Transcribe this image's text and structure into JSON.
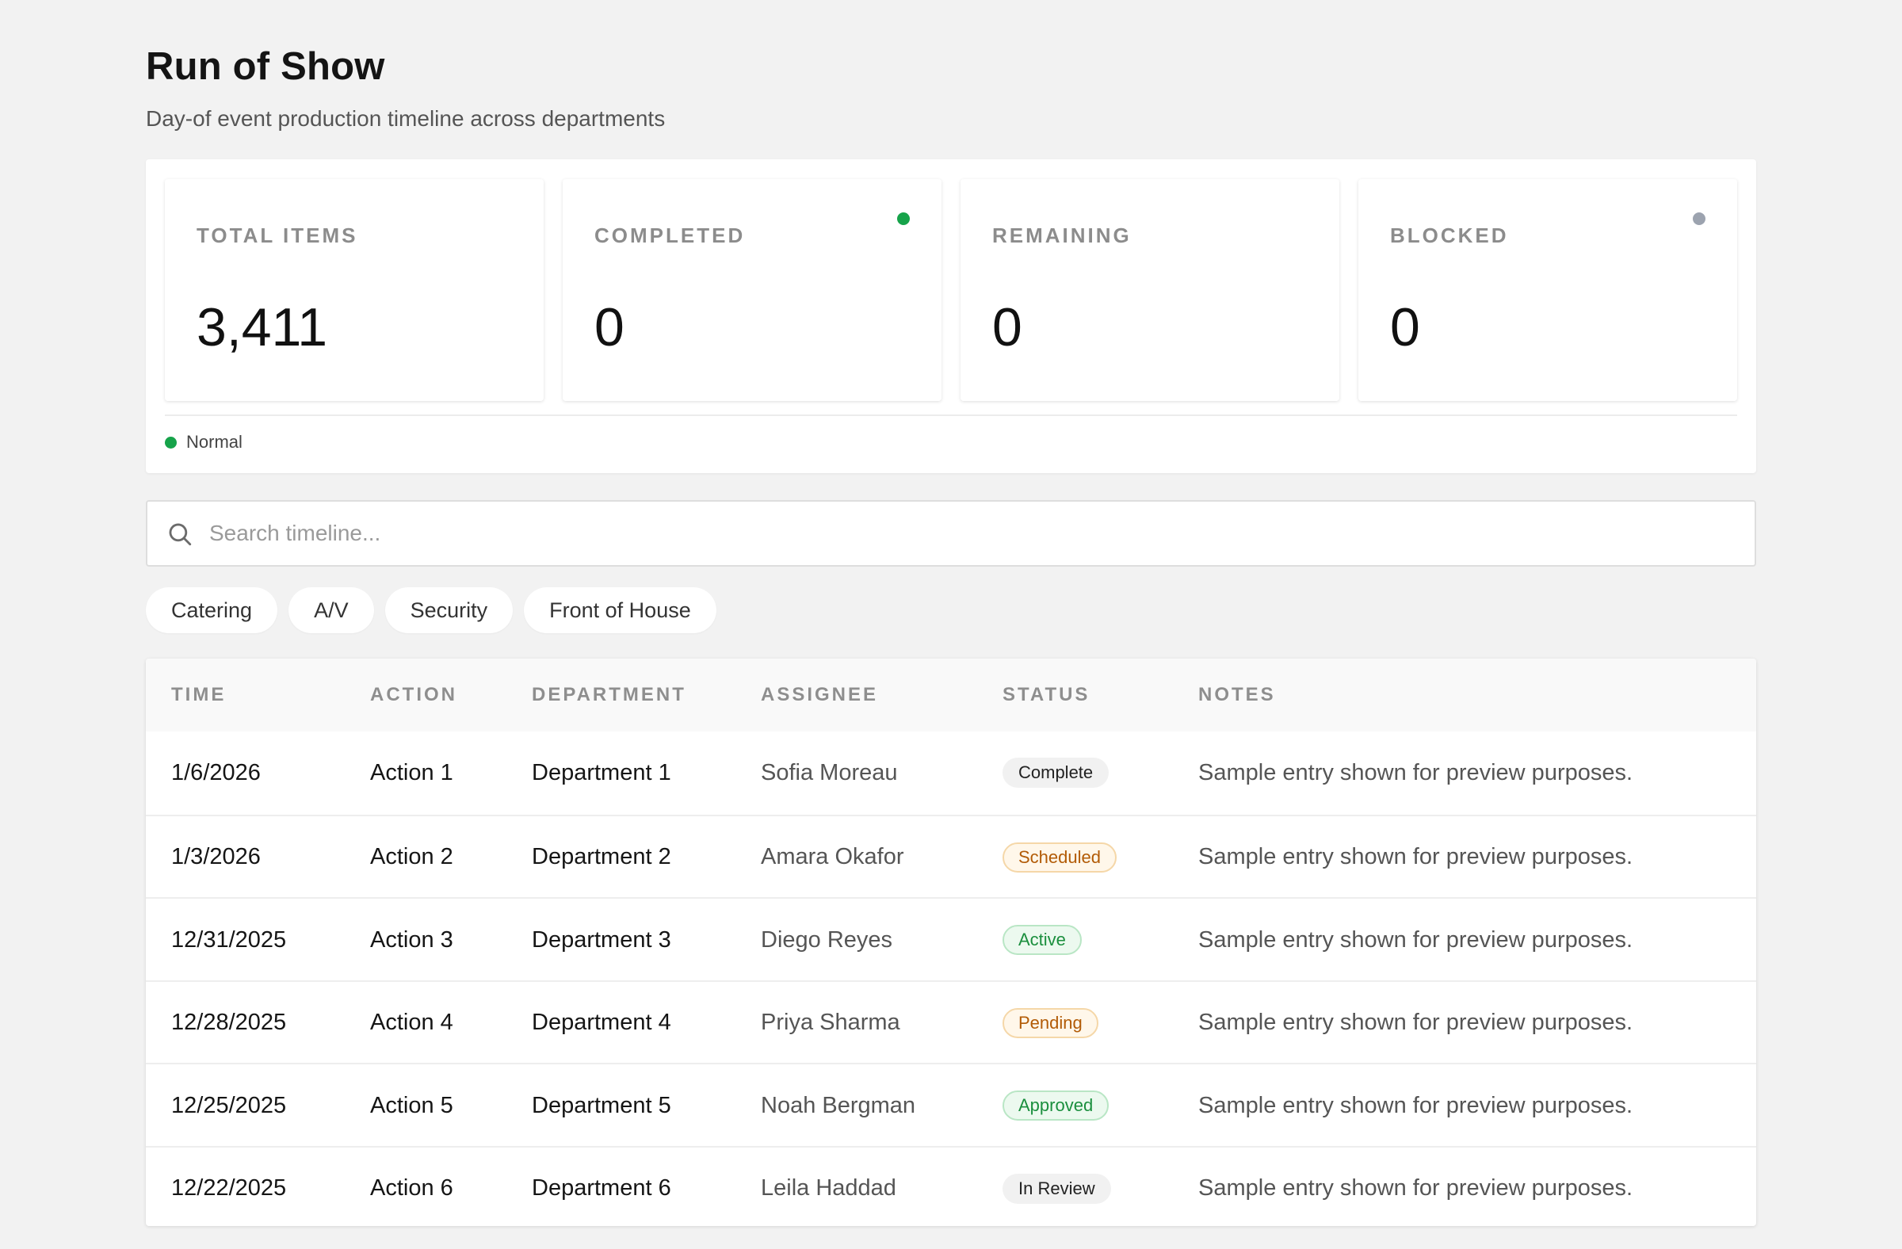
{
  "header": {
    "title": "Run of Show",
    "subtitle": "Day-of event production timeline across departments"
  },
  "stats": [
    {
      "label": "TOTAL ITEMS",
      "value": "3,411",
      "dot": null
    },
    {
      "label": "COMPLETED",
      "value": "0",
      "dot": "#16a34a"
    },
    {
      "label": "REMAINING",
      "value": "0",
      "dot": null
    },
    {
      "label": "BLOCKED",
      "value": "0",
      "dot": "#9ca3af"
    }
  ],
  "legend": {
    "label": "Normal",
    "color": "#16a34a"
  },
  "search": {
    "placeholder": "Search timeline..."
  },
  "filters": [
    "Catering",
    "A/V",
    "Security",
    "Front of House"
  ],
  "table": {
    "columns": [
      "TIME",
      "ACTION",
      "DEPARTMENT",
      "ASSIGNEE",
      "STATUS",
      "NOTES"
    ],
    "rows": [
      {
        "time": "1/6/2026",
        "action": "Action 1",
        "department": "Department 1",
        "assignee": "Sofia Moreau",
        "status": "Complete",
        "notes": "Sample entry shown for preview purposes."
      },
      {
        "time": "1/3/2026",
        "action": "Action 2",
        "department": "Department 2",
        "assignee": "Amara Okafor",
        "status": "Scheduled",
        "notes": "Sample entry shown for preview purposes."
      },
      {
        "time": "12/31/2025",
        "action": "Action 3",
        "department": "Department 3",
        "assignee": "Diego Reyes",
        "status": "Active",
        "notes": "Sample entry shown for preview purposes."
      },
      {
        "time": "12/28/2025",
        "action": "Action 4",
        "department": "Department 4",
        "assignee": "Priya Sharma",
        "status": "Pending",
        "notes": "Sample entry shown for preview purposes."
      },
      {
        "time": "12/25/2025",
        "action": "Action 5",
        "department": "Department 5",
        "assignee": "Noah Bergman",
        "status": "Approved",
        "notes": "Sample entry shown for preview purposes."
      },
      {
        "time": "12/22/2025",
        "action": "Action 6",
        "department": "Department 6",
        "assignee": "Leila Haddad",
        "status": "In Review",
        "notes": "Sample entry shown for preview purposes."
      }
    ]
  },
  "icons": {
    "search": "search-icon"
  }
}
